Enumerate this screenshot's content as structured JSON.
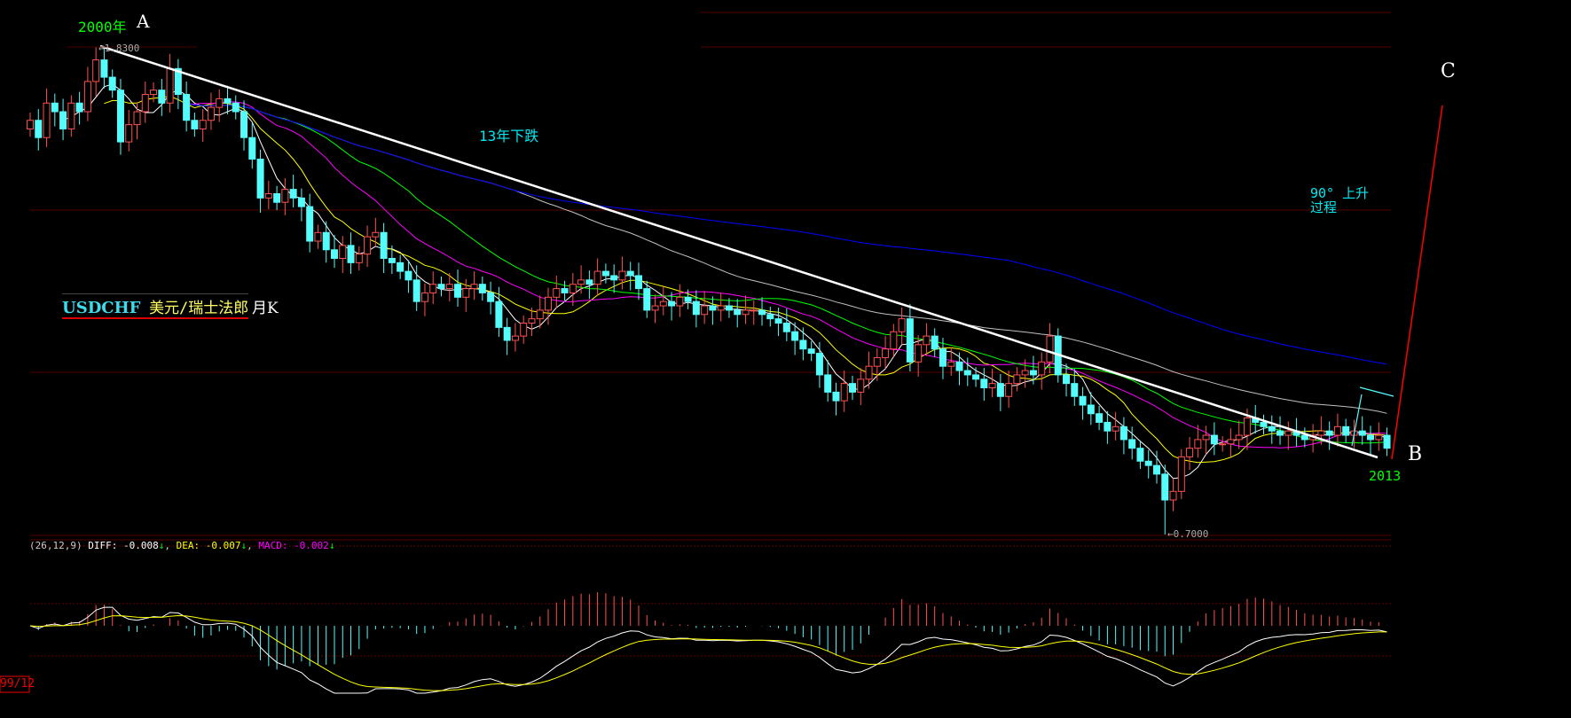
{
  "chart_data": {
    "type": "candlestick",
    "symbol": "USDCHF",
    "symbol_name": "美元/瑞士法郎",
    "period": "月K",
    "start_label": "99/12",
    "ylim": [
      0.7,
      1.83
    ],
    "annotations": {
      "year_start": "2000年",
      "point_a": "A",
      "point_b": "B",
      "point_c": "C",
      "decline_text": "13年下跌",
      "rise_text_1": "90° 上升",
      "rise_text_2": "过程",
      "year_end": "2013",
      "high_label": "←1.8300",
      "high_value": 1.83,
      "low_label": "←0.7000",
      "low_value": 0.7
    },
    "closes": [
      1.66,
      1.62,
      1.7,
      1.68,
      1.64,
      1.7,
      1.68,
      1.75,
      1.8,
      1.76,
      1.73,
      1.61,
      1.65,
      1.68,
      1.72,
      1.73,
      1.7,
      1.78,
      1.72,
      1.66,
      1.64,
      1.66,
      1.69,
      1.71,
      1.7,
      1.68,
      1.62,
      1.57,
      1.48,
      1.49,
      1.47,
      1.5,
      1.48,
      1.46,
      1.38,
      1.4,
      1.36,
      1.34,
      1.37,
      1.33,
      1.35,
      1.39,
      1.4,
      1.34,
      1.33,
      1.31,
      1.29,
      1.24,
      1.26,
      1.28,
      1.27,
      1.28,
      1.25,
      1.27,
      1.28,
      1.26,
      1.24,
      1.18,
      1.15,
      1.16,
      1.19,
      1.2,
      1.22,
      1.25,
      1.27,
      1.26,
      1.28,
      1.29,
      1.28,
      1.31,
      1.3,
      1.29,
      1.31,
      1.3,
      1.27,
      1.22,
      1.23,
      1.24,
      1.23,
      1.25,
      1.24,
      1.21,
      1.23,
      1.22,
      1.23,
      1.22,
      1.21,
      1.22,
      1.22,
      1.21,
      1.2,
      1.19,
      1.17,
      1.15,
      1.13,
      1.12,
      1.07,
      1.03,
      1.01,
      1.05,
      1.03,
      1.06,
      1.09,
      1.11,
      1.13,
      1.17,
      1.2,
      1.1,
      1.14,
      1.16,
      1.13,
      1.09,
      1.1,
      1.08,
      1.07,
      1.06,
      1.04,
      1.05,
      1.02,
      1.05,
      1.07,
      1.08,
      1.07,
      1.1,
      1.16,
      1.07,
      1.05,
      1.02,
      1.0,
      0.98,
      0.96,
      0.94,
      0.95,
      0.92,
      0.9,
      0.87,
      0.86,
      0.84,
      0.78,
      0.8,
      0.88,
      0.9,
      0.92,
      0.93,
      0.91,
      0.91,
      0.92,
      0.93,
      0.97,
      0.96,
      0.95,
      0.94,
      0.93,
      0.94,
      0.93,
      0.92,
      0.93,
      0.94,
      0.93,
      0.95,
      0.93,
      0.94,
      0.93,
      0.92,
      0.93,
      0.9
    ],
    "moving_averages": [
      {
        "period": 5,
        "color": "#ffffff"
      },
      {
        "period": 10,
        "color": "#ffff00"
      },
      {
        "period": 20,
        "color": "#ff00ff"
      },
      {
        "period": 30,
        "color": "#00ff00"
      },
      {
        "period": 60,
        "color": "#c0c0c0"
      },
      {
        "period": 120,
        "color": "#0000ff"
      }
    ],
    "colors": {
      "up": "#ff5050",
      "down": "#54fcfc",
      "grid": "#800000",
      "trendline": "#ffffff",
      "rise_line": "#ff0000"
    },
    "macd": {
      "params": "(26,12,9)",
      "diff_label": "DIFF: -0.008",
      "dea_label": "DEA: -0.007",
      "macd_label": "MACD: -0.002",
      "arrow": "↓",
      "sep": ","
    }
  }
}
